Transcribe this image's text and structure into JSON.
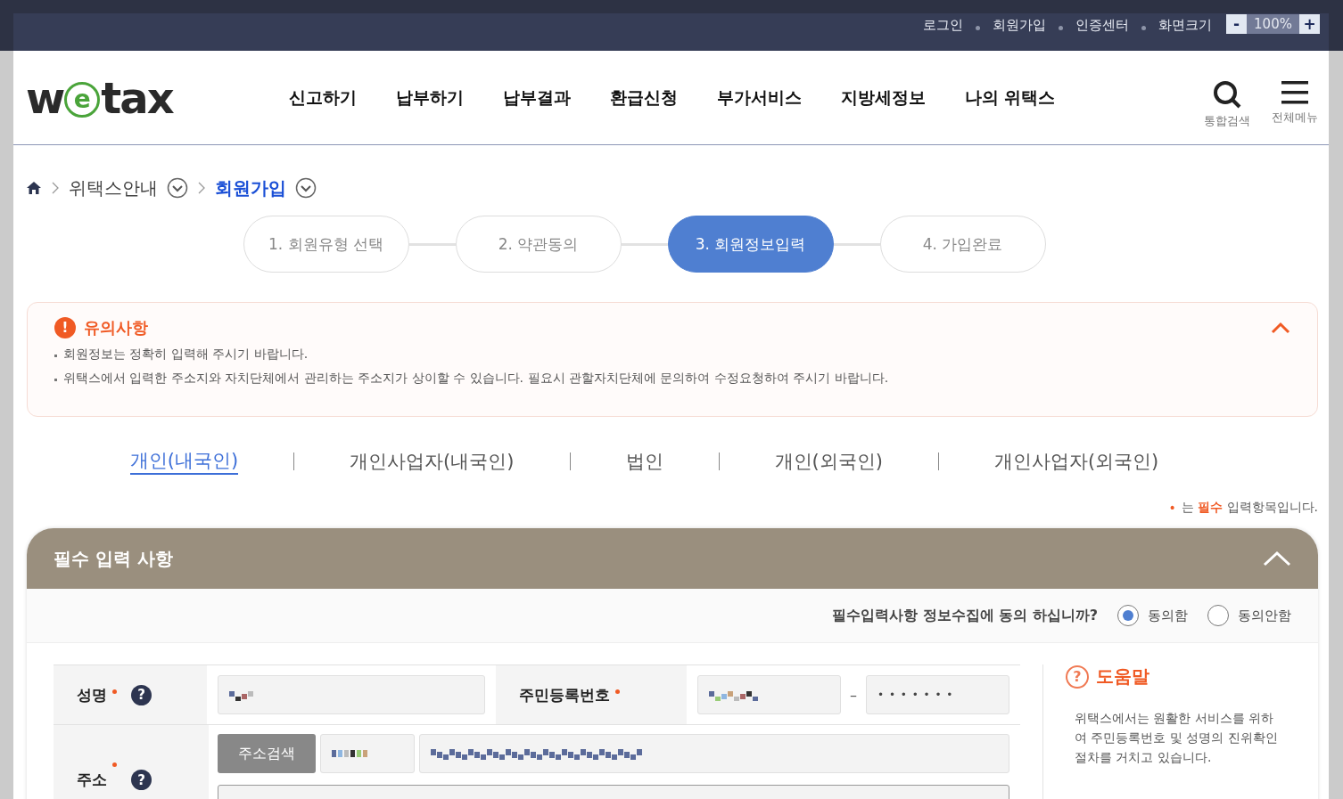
{
  "top_bar": {
    "links": [
      "로그인",
      "회원가입",
      "인증센터",
      "화면크기"
    ],
    "zoom": {
      "minus": "-",
      "value": "100%",
      "plus": "+"
    }
  },
  "header": {
    "logo": {
      "before": "w",
      "mark": "e",
      "after": "tax"
    },
    "nav": [
      "신고하기",
      "납부하기",
      "납부결과",
      "환급신청",
      "부가서비스",
      "지방세정보",
      "나의 위택스"
    ],
    "tools": [
      {
        "kind": "search",
        "label": "통합검색"
      },
      {
        "kind": "menu",
        "label": "전체메뉴"
      }
    ]
  },
  "breadcrumb": [
    {
      "label": "위택스안내",
      "current": false
    },
    {
      "label": "회원가입",
      "current": true
    }
  ],
  "steps": [
    {
      "label": "1. 회원유형 선택",
      "selected": false
    },
    {
      "label": "2. 약관동의",
      "selected": false
    },
    {
      "label": "3. 회원정보입력",
      "selected": true
    },
    {
      "label": "4. 가입완료",
      "selected": false
    }
  ],
  "notice": {
    "icon": "!",
    "title": "유의사항",
    "expanded": true,
    "items": [
      "회원정보는 정확히 입력해 주시기 바랍니다.",
      "위택스에서 입력한 주소지와 자치단체에서 관리하는 주소지가 상이할 수 있습니다. 필요시 관할자치단체에 문의하여 수정요청하여 주시기 바랍니다."
    ]
  },
  "member_tabs": [
    {
      "label": "개인(내국인)",
      "selected": true
    },
    {
      "label": "개인사업자(내국인)",
      "selected": false
    },
    {
      "label": "법인",
      "selected": false
    },
    {
      "label": "개인(외국인)",
      "selected": false
    },
    {
      "label": "개인사업자(외국인)",
      "selected": false
    }
  ],
  "required_note": {
    "mark": "•",
    "before": "는",
    "emphasis": "필수",
    "after": "입력항목입니다."
  },
  "section": {
    "title": "필수 입력 사항",
    "expanded": true,
    "consent": {
      "question": "필수입력사항 정보수집에 동의 하십니까?",
      "options": [
        {
          "label": "동의함",
          "selected": true
        },
        {
          "label": "동의안함",
          "selected": false
        }
      ]
    },
    "name_row": {
      "label": "성명",
      "required": true,
      "help": "?",
      "rrn_label": "주민등록번호",
      "rrn_required": true,
      "separator": "–",
      "rrn_back": "• • • • • • •"
    },
    "address_row": {
      "label": "주소",
      "required": true,
      "help": "?",
      "button": "주소검색"
    },
    "help_panel": {
      "icon": "?",
      "title": "도움말",
      "text": "위택스에서는 원활한 서비스를 위하여 주민등록번호 및 성명의 진위확인 절차를 거치고 있습니다."
    }
  }
}
